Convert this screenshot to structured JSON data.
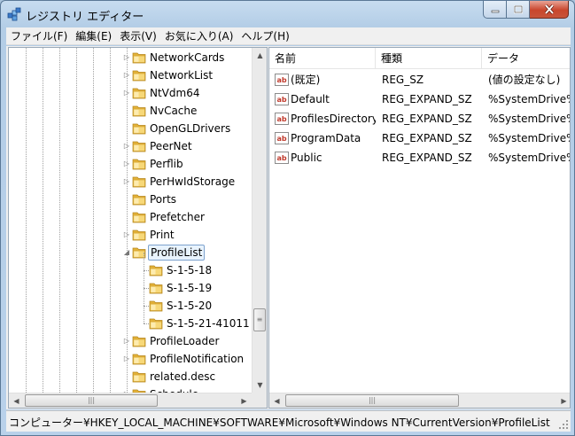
{
  "window": {
    "title": "レジストリ エディター"
  },
  "menu": [
    "ファイル(F)",
    "編集(E)",
    "表示(V)",
    "お気に入り(A)",
    "ヘルプ(H)"
  ],
  "tree": [
    {
      "label": "NetworkCards",
      "level": 1,
      "expander": "▷"
    },
    {
      "label": "NetworkList",
      "level": 1,
      "expander": "▷"
    },
    {
      "label": "NtVdm64",
      "level": 1,
      "expander": "▷"
    },
    {
      "label": "NvCache",
      "level": 1,
      "expander": ""
    },
    {
      "label": "OpenGLDrivers",
      "level": 1,
      "expander": ""
    },
    {
      "label": "PeerNet",
      "level": 1,
      "expander": "▷"
    },
    {
      "label": "Perflib",
      "level": 1,
      "expander": "▷"
    },
    {
      "label": "PerHwIdStorage",
      "level": 1,
      "expander": "▷"
    },
    {
      "label": "Ports",
      "level": 1,
      "expander": ""
    },
    {
      "label": "Prefetcher",
      "level": 1,
      "expander": ""
    },
    {
      "label": "Print",
      "level": 1,
      "expander": "▷"
    },
    {
      "label": "ProfileList",
      "level": 1,
      "expander": "◢",
      "selected": true
    },
    {
      "label": "S-1-5-18",
      "level": 2,
      "expander": ""
    },
    {
      "label": "S-1-5-19",
      "level": 2,
      "expander": ""
    },
    {
      "label": "S-1-5-20",
      "level": 2,
      "expander": ""
    },
    {
      "label": "S-1-5-21-41011",
      "level": 2,
      "expander": ""
    },
    {
      "label": "ProfileLoader",
      "level": 1,
      "expander": "▷"
    },
    {
      "label": "ProfileNotification",
      "level": 1,
      "expander": "▷"
    },
    {
      "label": "related.desc",
      "level": 1,
      "expander": ""
    },
    {
      "label": "Schedule",
      "level": 1,
      "expander": "▷"
    }
  ],
  "list": {
    "columns": [
      "名前",
      "種類",
      "データ"
    ],
    "rows": [
      {
        "name": "(既定)",
        "type": "REG_SZ",
        "data": "(値の設定なし)"
      },
      {
        "name": "Default",
        "type": "REG_EXPAND_SZ",
        "data": "%SystemDrive%"
      },
      {
        "name": "ProfilesDirectory",
        "type": "REG_EXPAND_SZ",
        "data": "%SystemDrive%"
      },
      {
        "name": "ProgramData",
        "type": "REG_EXPAND_SZ",
        "data": "%SystemDrive%"
      },
      {
        "name": "Public",
        "type": "REG_EXPAND_SZ",
        "data": "%SystemDrive%"
      }
    ]
  },
  "status": {
    "path": "コンピューター¥HKEY_LOCAL_MACHINE¥SOFTWARE¥Microsoft¥Windows NT¥CurrentVersion¥ProfileList"
  },
  "icons": {
    "app": "registry-editor-icon",
    "folder": "folder-icon",
    "value": "string-value-icon",
    "minimize": "minimize-icon",
    "maximize": "maximize-icon",
    "close": "close-icon"
  },
  "colors": {
    "close_button": "#c9462c",
    "selection_border": "#7da2ce",
    "folder": "#f2c94c"
  }
}
